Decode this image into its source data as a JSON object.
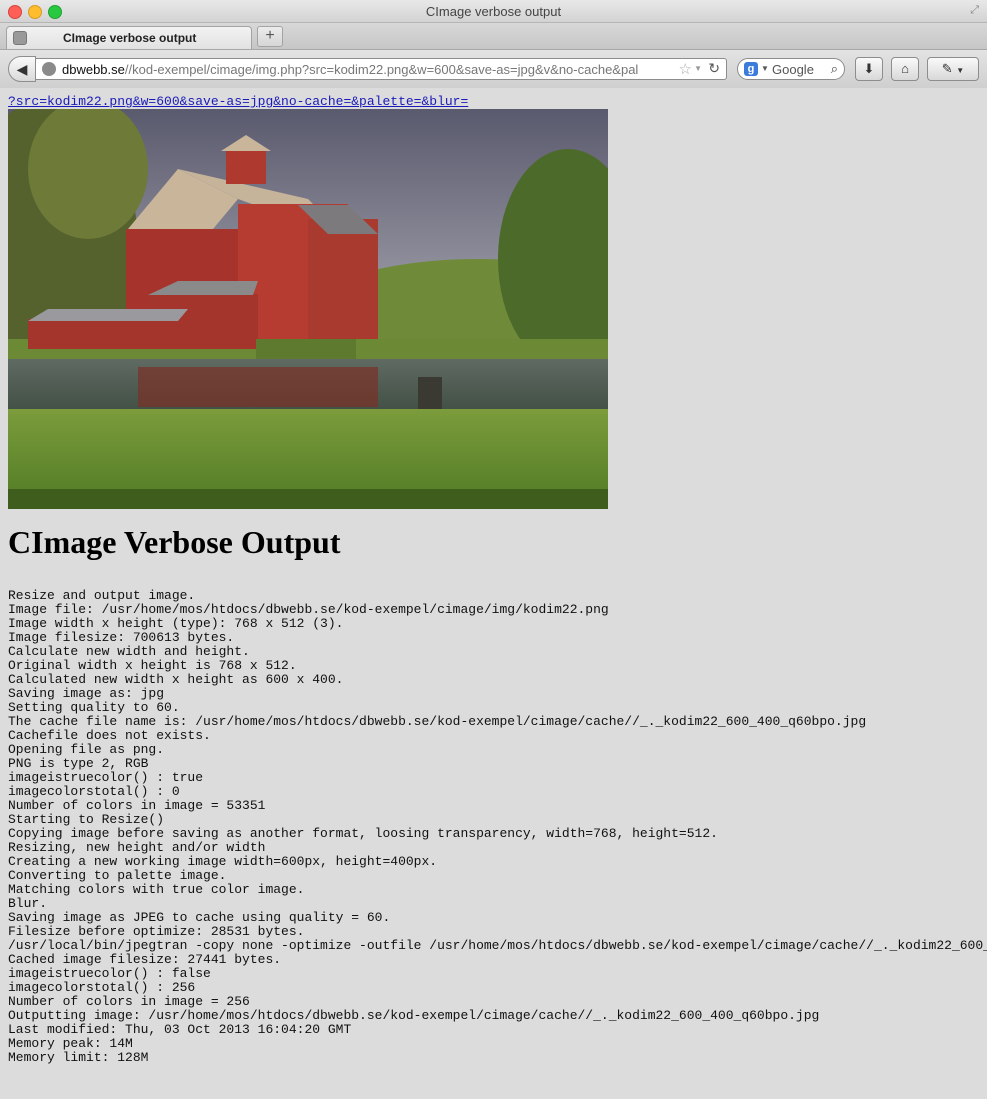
{
  "window": {
    "title": "CImage verbose output"
  },
  "tab": {
    "label": "CImage verbose output"
  },
  "address": {
    "host": "dbwebb.se",
    "path": "//kod-exempel/cimage/img.php?src=kodim22.png&w=600&save-as=jpg&v&no-cache&pal"
  },
  "search": {
    "placeholder": "Google"
  },
  "page": {
    "query_link": "?src=kodim22.png&w=600&save-as=jpg&no-cache=&palette=&blur=",
    "heading": "CImage Verbose Output",
    "log": [
      "Resize and output image.",
      "Image file: /usr/home/mos/htdocs/dbwebb.se/kod-exempel/cimage/img/kodim22.png",
      "Image width x height (type): 768 x 512 (3).",
      "Image filesize: 700613 bytes.",
      "Calculate new width and height.",
      "Original width x height is 768 x 512.",
      "Calculated new width x height as 600 x 400.",
      "Saving image as: jpg",
      "Setting quality to 60.",
      "The cache file name is: /usr/home/mos/htdocs/dbwebb.se/kod-exempel/cimage/cache//_._kodim22_600_400_q60bpo.jpg",
      "Cachefile does not exists.",
      "Opening file as png.",
      "PNG is type 2, RGB",
      "imageistruecolor() : true",
      "imagecolorstotal() : 0",
      "Number of colors in image = 53351",
      "Starting to Resize()",
      "Copying image before saving as another format, loosing transparency, width=768, height=512.",
      "Resizing, new height and/or width",
      "Creating a new working image width=600px, height=400px.",
      "Converting to palette image.",
      "Matching colors with true color image.",
      "Blur.",
      "Saving image as JPEG to cache using quality = 60.",
      "Filesize before optimize: 28531 bytes.",
      "/usr/local/bin/jpegtran -copy none -optimize -outfile /usr/home/mos/htdocs/dbwebb.se/kod-exempel/cimage/cache//_._kodim22_600_",
      "Cached image filesize: 27441 bytes.",
      "imageistruecolor() : false",
      "imagecolorstotal() : 256",
      "Number of colors in image = 256",
      "Outputting image: /usr/home/mos/htdocs/dbwebb.se/kod-exempel/cimage/cache//_._kodim22_600_400_q60bpo.jpg",
      "Last modified: Thu, 03 Oct 2013 16:04:20 GMT",
      "Memory peak: 14M",
      "Memory limit: 128M"
    ]
  }
}
